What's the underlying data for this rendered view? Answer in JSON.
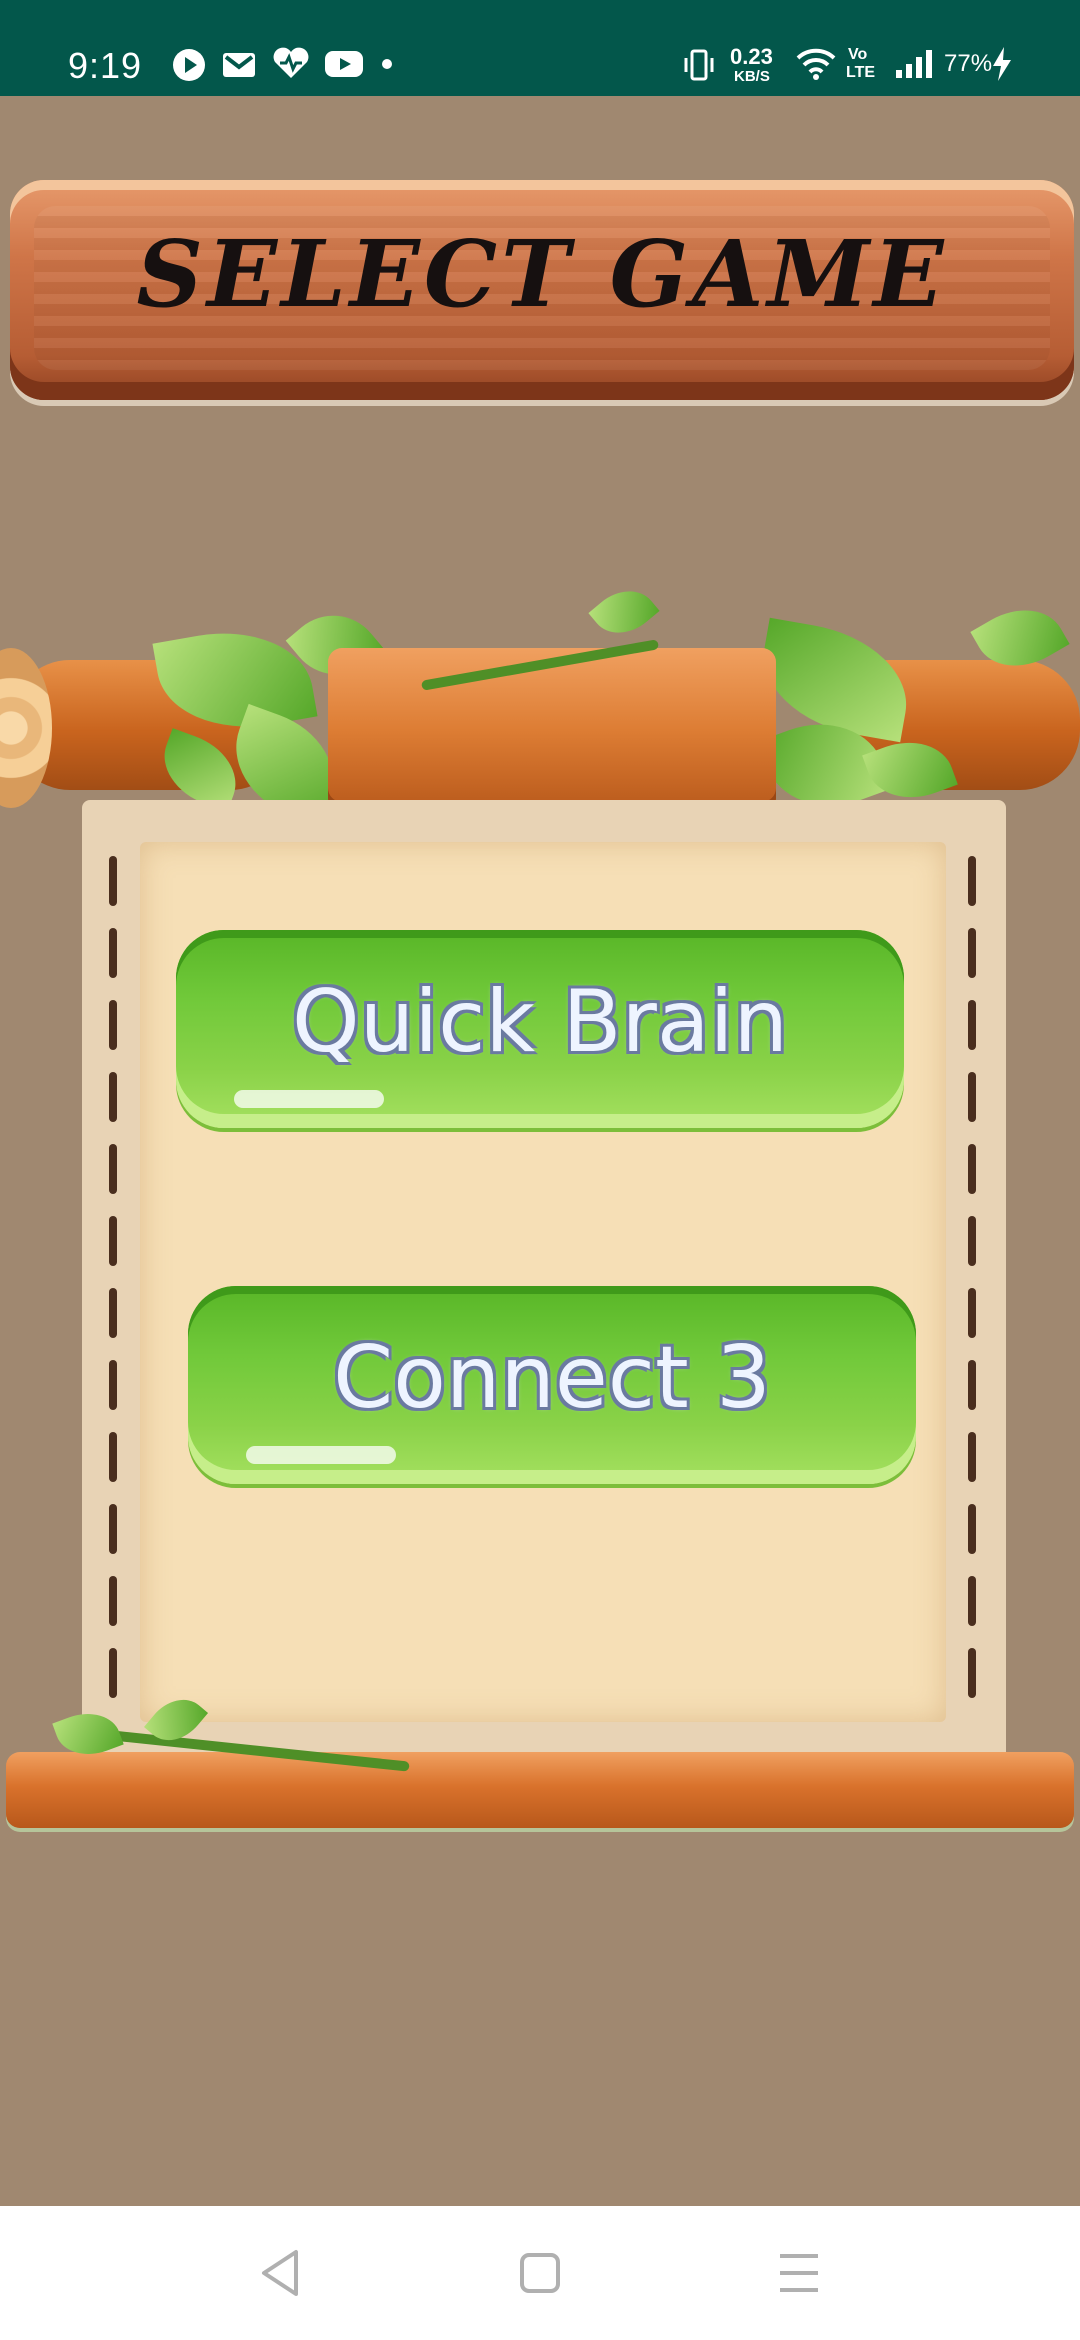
{
  "status_bar": {
    "time": "9:19",
    "notification_icons": [
      "play-icon",
      "gmail-icon",
      "health-heart-icon",
      "youtube-icon",
      "dot-icon"
    ],
    "network_speed_value": "0.23",
    "network_speed_unit": "KB/S",
    "volte_top": "Vo",
    "volte_bottom": "LTE",
    "battery": "77%"
  },
  "header": {
    "title": "SELECT GAME"
  },
  "games": [
    {
      "label": "Quick Brain"
    },
    {
      "label": "Connect 3"
    }
  ],
  "colors": {
    "status_bar_bg": "#03574b",
    "background": "#a08870",
    "button_green": "#71c93a",
    "paper": "#f6dfb6",
    "wood": "#cf7548"
  },
  "nav_bar": {
    "icons": [
      "back-icon",
      "home-icon",
      "menu-icon"
    ]
  }
}
